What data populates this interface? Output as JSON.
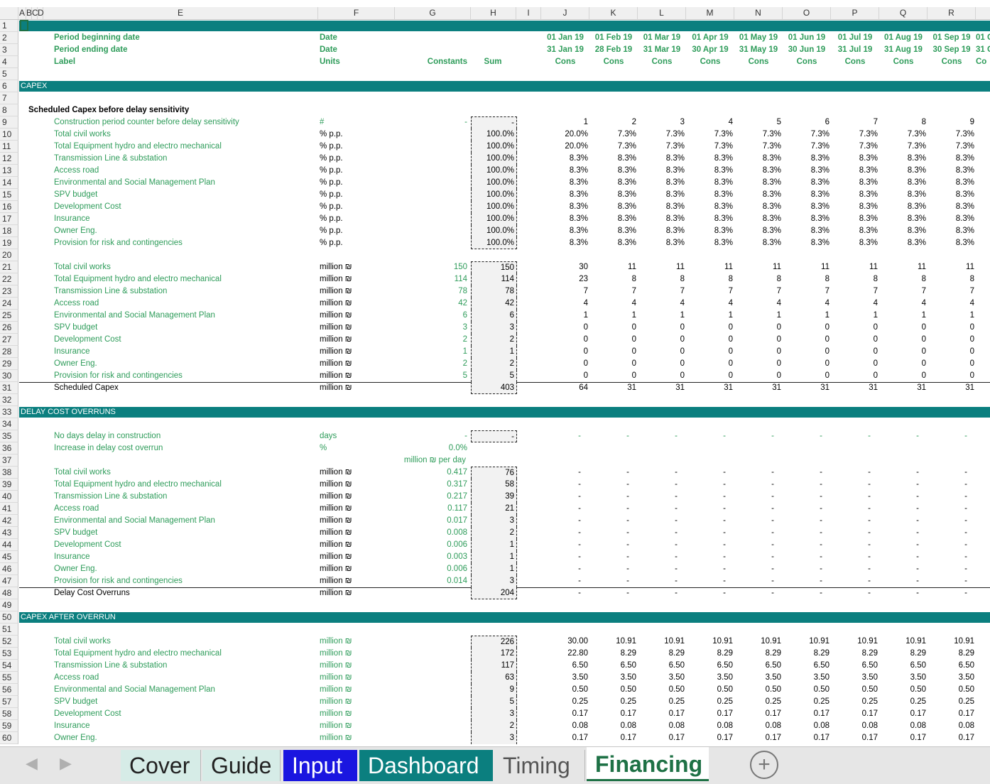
{
  "columns": [
    "A",
    "B",
    "C",
    "D",
    "E",
    "F",
    "G",
    "H",
    "I",
    "J",
    "K",
    "L",
    "M",
    "N",
    "O",
    "P",
    "Q",
    "R"
  ],
  "colors": {
    "section_bar": "#0b7f7f",
    "input_green": "#2e9c5a",
    "tab_input": "#1a16e0",
    "tab_dashboard": "#0b7f7f"
  },
  "rows": [
    {
      "n": "1",
      "type": "bar",
      "title": ""
    },
    {
      "n": "2",
      "e": "Period beginning date",
      "f": "Date",
      "vals": [
        "01 Jan 19",
        "01 Feb 19",
        "01 Mar 19",
        "01 Apr 19",
        "01 May 19",
        "01 Jun 19",
        "01 Jul 19",
        "01 Aug 19",
        "01 Sep 19",
        "01 O"
      ],
      "cls": "g bold"
    },
    {
      "n": "3",
      "e": "Period ending date",
      "f": "Date",
      "vals": [
        "31 Jan 19",
        "28 Feb 19",
        "31 Mar 19",
        "30 Apr 19",
        "31 May 19",
        "30 Jun 19",
        "31 Jul 19",
        "31 Aug 19",
        "30 Sep 19",
        "31 O"
      ],
      "cls": "g bold"
    },
    {
      "n": "4",
      "e": "Label",
      "f": "Units",
      "g": "Constants",
      "h": "Sum",
      "vals": [
        "Cons",
        "Cons",
        "Cons",
        "Cons",
        "Cons",
        "Cons",
        "Cons",
        "Cons",
        "Cons",
        "Co"
      ],
      "cls": "g bold"
    },
    {
      "n": "5"
    },
    {
      "n": "6",
      "type": "bar",
      "title": "CAPEX"
    },
    {
      "n": "7"
    },
    {
      "n": "8",
      "label": "Scheduled Capex before delay sensitivity"
    },
    {
      "n": "9",
      "e": "Construction period counter before delay sensitivity",
      "f": "#",
      "g": "-",
      "h": "-",
      "hbox": "top",
      "vals": [
        "1",
        "2",
        "3",
        "4",
        "5",
        "6",
        "7",
        "8",
        "9"
      ]
    },
    {
      "n": "10",
      "e": "Total civil works",
      "f": "% p.p.",
      "h": "100.0%",
      "hbox": "mid",
      "vals": [
        "20.0%",
        "7.3%",
        "7.3%",
        "7.3%",
        "7.3%",
        "7.3%",
        "7.3%",
        "7.3%",
        "7.3%"
      ]
    },
    {
      "n": "11",
      "e": "Total Equipment hydro and electro mechanical",
      "f": "% p.p.",
      "h": "100.0%",
      "hbox": "mid",
      "vals": [
        "20.0%",
        "7.3%",
        "7.3%",
        "7.3%",
        "7.3%",
        "7.3%",
        "7.3%",
        "7.3%",
        "7.3%"
      ]
    },
    {
      "n": "12",
      "e": "Transmission Line & substation",
      "f": "% p.p.",
      "h": "100.0%",
      "hbox": "mid",
      "vals": [
        "8.3%",
        "8.3%",
        "8.3%",
        "8.3%",
        "8.3%",
        "8.3%",
        "8.3%",
        "8.3%",
        "8.3%"
      ]
    },
    {
      "n": "13",
      "e": "Access road",
      "f": "% p.p.",
      "h": "100.0%",
      "hbox": "mid",
      "vals": [
        "8.3%",
        "8.3%",
        "8.3%",
        "8.3%",
        "8.3%",
        "8.3%",
        "8.3%",
        "8.3%",
        "8.3%"
      ]
    },
    {
      "n": "14",
      "e": "Environmental and Social Management Plan",
      "f": "% p.p.",
      "h": "100.0%",
      "hbox": "mid",
      "vals": [
        "8.3%",
        "8.3%",
        "8.3%",
        "8.3%",
        "8.3%",
        "8.3%",
        "8.3%",
        "8.3%",
        "8.3%"
      ]
    },
    {
      "n": "15",
      "e": "SPV budget",
      "f": "% p.p.",
      "h": "100.0%",
      "hbox": "mid",
      "vals": [
        "8.3%",
        "8.3%",
        "8.3%",
        "8.3%",
        "8.3%",
        "8.3%",
        "8.3%",
        "8.3%",
        "8.3%"
      ]
    },
    {
      "n": "16",
      "e": "Development Cost",
      "f": "% p.p.",
      "h": "100.0%",
      "hbox": "mid",
      "vals": [
        "8.3%",
        "8.3%",
        "8.3%",
        "8.3%",
        "8.3%",
        "8.3%",
        "8.3%",
        "8.3%",
        "8.3%"
      ]
    },
    {
      "n": "17",
      "e": "Insurance",
      "f": "% p.p.",
      "h": "100.0%",
      "hbox": "mid",
      "vals": [
        "8.3%",
        "8.3%",
        "8.3%",
        "8.3%",
        "8.3%",
        "8.3%",
        "8.3%",
        "8.3%",
        "8.3%"
      ]
    },
    {
      "n": "18",
      "e": "Owner Eng.",
      "f": "% p.p.",
      "h": "100.0%",
      "hbox": "mid",
      "vals": [
        "8.3%",
        "8.3%",
        "8.3%",
        "8.3%",
        "8.3%",
        "8.3%",
        "8.3%",
        "8.3%",
        "8.3%"
      ]
    },
    {
      "n": "19",
      "e": "Provision for risk and contingencies",
      "f": "% p.p.",
      "h": "100.0%",
      "hbox": "bot",
      "vals": [
        "8.3%",
        "8.3%",
        "8.3%",
        "8.3%",
        "8.3%",
        "8.3%",
        "8.3%",
        "8.3%",
        "8.3%"
      ]
    },
    {
      "n": "20"
    },
    {
      "n": "21",
      "e": "Total civil works",
      "f": "million ₪",
      "g": "150",
      "h": "150",
      "hbox": "top",
      "vals": [
        "30",
        "11",
        "11",
        "11",
        "11",
        "11",
        "11",
        "11",
        "11"
      ]
    },
    {
      "n": "22",
      "e": "Total Equipment hydro and electro mechanical",
      "f": "million ₪",
      "g": "114",
      "h": "114",
      "hbox": "mid",
      "vals": [
        "23",
        "8",
        "8",
        "8",
        "8",
        "8",
        "8",
        "8",
        "8"
      ]
    },
    {
      "n": "23",
      "e": "Transmission Line & substation",
      "f": "million ₪",
      "g": "78",
      "h": "78",
      "hbox": "mid",
      "vals": [
        "7",
        "7",
        "7",
        "7",
        "7",
        "7",
        "7",
        "7",
        "7"
      ]
    },
    {
      "n": "24",
      "e": "Access road",
      "f": "million ₪",
      "g": "42",
      "h": "42",
      "hbox": "mid",
      "vals": [
        "4",
        "4",
        "4",
        "4",
        "4",
        "4",
        "4",
        "4",
        "4"
      ]
    },
    {
      "n": "25",
      "e": "Environmental and Social Management Plan",
      "f": "million ₪",
      "g": "6",
      "h": "6",
      "hbox": "mid",
      "vals": [
        "1",
        "1",
        "1",
        "1",
        "1",
        "1",
        "1",
        "1",
        "1"
      ]
    },
    {
      "n": "26",
      "e": "SPV budget",
      "f": "million ₪",
      "g": "3",
      "h": "3",
      "hbox": "mid",
      "vals": [
        "0",
        "0",
        "0",
        "0",
        "0",
        "0",
        "0",
        "0",
        "0"
      ]
    },
    {
      "n": "27",
      "e": "Development Cost",
      "f": "million ₪",
      "g": "2",
      "h": "2",
      "hbox": "mid",
      "vals": [
        "0",
        "0",
        "0",
        "0",
        "0",
        "0",
        "0",
        "0",
        "0"
      ]
    },
    {
      "n": "28",
      "e": "Insurance",
      "f": "million ₪",
      "g": "1",
      "h": "1",
      "hbox": "mid",
      "vals": [
        "0",
        "0",
        "0",
        "0",
        "0",
        "0",
        "0",
        "0",
        "0"
      ]
    },
    {
      "n": "29",
      "e": "Owner Eng.",
      "f": "million ₪",
      "g": "2",
      "h": "2",
      "hbox": "mid",
      "vals": [
        "0",
        "0",
        "0",
        "0",
        "0",
        "0",
        "0",
        "0",
        "0"
      ]
    },
    {
      "n": "30",
      "e": "Provision for risk and contingencies",
      "f": "million ₪",
      "g": "5",
      "h": "5",
      "hbox": "mid",
      "vals": [
        "0",
        "0",
        "0",
        "0",
        "0",
        "0",
        "0",
        "0",
        "0"
      ]
    },
    {
      "n": "31",
      "e": "Scheduled Capex",
      "f": "million ₪",
      "h": "403",
      "hbox": "bot",
      "total": true,
      "vals": [
        "64",
        "31",
        "31",
        "31",
        "31",
        "31",
        "31",
        "31",
        "31"
      ]
    },
    {
      "n": "32"
    },
    {
      "n": "33",
      "type": "bar",
      "title": "DELAY COST OVERRUNS"
    },
    {
      "n": "34"
    },
    {
      "n": "35",
      "e": "No days delay in construction",
      "f": "days",
      "fcls": "g",
      "g": "-",
      "h": "-",
      "hbox": "single",
      "vals": [
        "-",
        "-",
        "-",
        "-",
        "-",
        "-",
        "-",
        "-",
        "-"
      ],
      "vcls": "g"
    },
    {
      "n": "36",
      "e": "Increase in delay cost overrun",
      "f": "%",
      "fcls": "g",
      "g": "0.0%",
      "vals": []
    },
    {
      "n": "37",
      "gwide": "million ₪ per day",
      "vals": []
    },
    {
      "n": "38",
      "e": "Total civil works",
      "f": "million ₪",
      "g": "0.417",
      "h": "76",
      "hbox": "top",
      "vals": [
        "-",
        "-",
        "-",
        "-",
        "-",
        "-",
        "-",
        "-",
        "-"
      ]
    },
    {
      "n": "39",
      "e": "Total Equipment hydro and electro mechanical",
      "f": "million ₪",
      "g": "0.317",
      "h": "58",
      "hbox": "mid",
      "vals": [
        "-",
        "-",
        "-",
        "-",
        "-",
        "-",
        "-",
        "-",
        "-"
      ]
    },
    {
      "n": "40",
      "e": "Transmission Line & substation",
      "f": "million ₪",
      "g": "0.217",
      "h": "39",
      "hbox": "mid",
      "vals": [
        "-",
        "-",
        "-",
        "-",
        "-",
        "-",
        "-",
        "-",
        "-"
      ]
    },
    {
      "n": "41",
      "e": "Access road",
      "f": "million ₪",
      "g": "0.117",
      "h": "21",
      "hbox": "mid",
      "vals": [
        "-",
        "-",
        "-",
        "-",
        "-",
        "-",
        "-",
        "-",
        "-"
      ]
    },
    {
      "n": "42",
      "e": "Environmental and Social Management Plan",
      "f": "million ₪",
      "g": "0.017",
      "h": "3",
      "hbox": "mid",
      "vals": [
        "-",
        "-",
        "-",
        "-",
        "-",
        "-",
        "-",
        "-",
        "-"
      ]
    },
    {
      "n": "43",
      "e": "SPV budget",
      "f": "million ₪",
      "g": "0.008",
      "h": "2",
      "hbox": "mid",
      "vals": [
        "-",
        "-",
        "-",
        "-",
        "-",
        "-",
        "-",
        "-",
        "-"
      ]
    },
    {
      "n": "44",
      "e": "Development Cost",
      "f": "million ₪",
      "g": "0.006",
      "h": "1",
      "hbox": "mid",
      "vals": [
        "-",
        "-",
        "-",
        "-",
        "-",
        "-",
        "-",
        "-",
        "-"
      ]
    },
    {
      "n": "45",
      "e": "Insurance",
      "f": "million ₪",
      "g": "0.003",
      "h": "1",
      "hbox": "mid",
      "vals": [
        "-",
        "-",
        "-",
        "-",
        "-",
        "-",
        "-",
        "-",
        "-"
      ]
    },
    {
      "n": "46",
      "e": "Owner Eng.",
      "f": "million ₪",
      "g": "0.006",
      "h": "1",
      "hbox": "mid",
      "vals": [
        "-",
        "-",
        "-",
        "-",
        "-",
        "-",
        "-",
        "-",
        "-"
      ]
    },
    {
      "n": "47",
      "e": "Provision for risk and contingencies",
      "f": "million ₪",
      "g": "0.014",
      "h": "3",
      "hbox": "mid",
      "vals": [
        "-",
        "-",
        "-",
        "-",
        "-",
        "-",
        "-",
        "-",
        "-"
      ]
    },
    {
      "n": "48",
      "e": "Delay Cost Overruns",
      "f": "million ₪",
      "h": "204",
      "hbox": "bot",
      "total": true,
      "vals": [
        "-",
        "-",
        "-",
        "-",
        "-",
        "-",
        "-",
        "-",
        "-"
      ]
    },
    {
      "n": "49"
    },
    {
      "n": "50",
      "type": "bar",
      "title": "CAPEX AFTER OVERRUN"
    },
    {
      "n": "51"
    },
    {
      "n": "52",
      "e": "Total civil works",
      "f": "million ₪",
      "fcls": "g",
      "h": "226",
      "hbox": "top",
      "vals": [
        "30.00",
        "10.91",
        "10.91",
        "10.91",
        "10.91",
        "10.91",
        "10.91",
        "10.91",
        "10.91"
      ]
    },
    {
      "n": "53",
      "e": "Total Equipment hydro and electro mechanical",
      "f": "million ₪",
      "fcls": "g",
      "h": "172",
      "hbox": "mid",
      "vals": [
        "22.80",
        "8.29",
        "8.29",
        "8.29",
        "8.29",
        "8.29",
        "8.29",
        "8.29",
        "8.29"
      ]
    },
    {
      "n": "54",
      "e": "Transmission Line & substation",
      "f": "million ₪",
      "fcls": "g",
      "h": "117",
      "hbox": "mid",
      "vals": [
        "6.50",
        "6.50",
        "6.50",
        "6.50",
        "6.50",
        "6.50",
        "6.50",
        "6.50",
        "6.50"
      ]
    },
    {
      "n": "55",
      "e": "Access road",
      "f": "million ₪",
      "fcls": "g",
      "h": "63",
      "hbox": "mid",
      "vals": [
        "3.50",
        "3.50",
        "3.50",
        "3.50",
        "3.50",
        "3.50",
        "3.50",
        "3.50",
        "3.50"
      ]
    },
    {
      "n": "56",
      "e": "Environmental and Social Management Plan",
      "f": "million ₪",
      "fcls": "g",
      "h": "9",
      "hbox": "mid",
      "vals": [
        "0.50",
        "0.50",
        "0.50",
        "0.50",
        "0.50",
        "0.50",
        "0.50",
        "0.50",
        "0.50"
      ]
    },
    {
      "n": "57",
      "e": "SPV budget",
      "f": "million ₪",
      "fcls": "g",
      "h": "5",
      "hbox": "mid",
      "vals": [
        "0.25",
        "0.25",
        "0.25",
        "0.25",
        "0.25",
        "0.25",
        "0.25",
        "0.25",
        "0.25"
      ]
    },
    {
      "n": "58",
      "e": "Development Cost",
      "f": "million ₪",
      "fcls": "g",
      "h": "3",
      "hbox": "mid",
      "vals": [
        "0.17",
        "0.17",
        "0.17",
        "0.17",
        "0.17",
        "0.17",
        "0.17",
        "0.17",
        "0.17"
      ]
    },
    {
      "n": "59",
      "e": "Insurance",
      "f": "million ₪",
      "fcls": "g",
      "h": "2",
      "hbox": "mid",
      "vals": [
        "0.08",
        "0.08",
        "0.08",
        "0.08",
        "0.08",
        "0.08",
        "0.08",
        "0.08",
        "0.08"
      ]
    },
    {
      "n": "60",
      "e": "Owner Eng.",
      "f": "million ₪",
      "fcls": "g",
      "h": "3",
      "hbox": "mid",
      "vals": [
        "0.17",
        "0.17",
        "0.17",
        "0.17",
        "0.17",
        "0.17",
        "0.17",
        "0.17",
        "0.17"
      ]
    }
  ],
  "sheet_tabs": [
    {
      "label": "Cover",
      "style": "plain"
    },
    {
      "label": "Guide",
      "style": "plain"
    },
    {
      "label": "Input",
      "style": "input"
    },
    {
      "label": "Dashboard",
      "style": "dashboard"
    },
    {
      "label": "Timing",
      "style": "plain"
    },
    {
      "label": "Financing",
      "style": "active"
    }
  ],
  "add_sheet_symbol": "+",
  "nav_prev": "◀",
  "nav_next": "▶"
}
